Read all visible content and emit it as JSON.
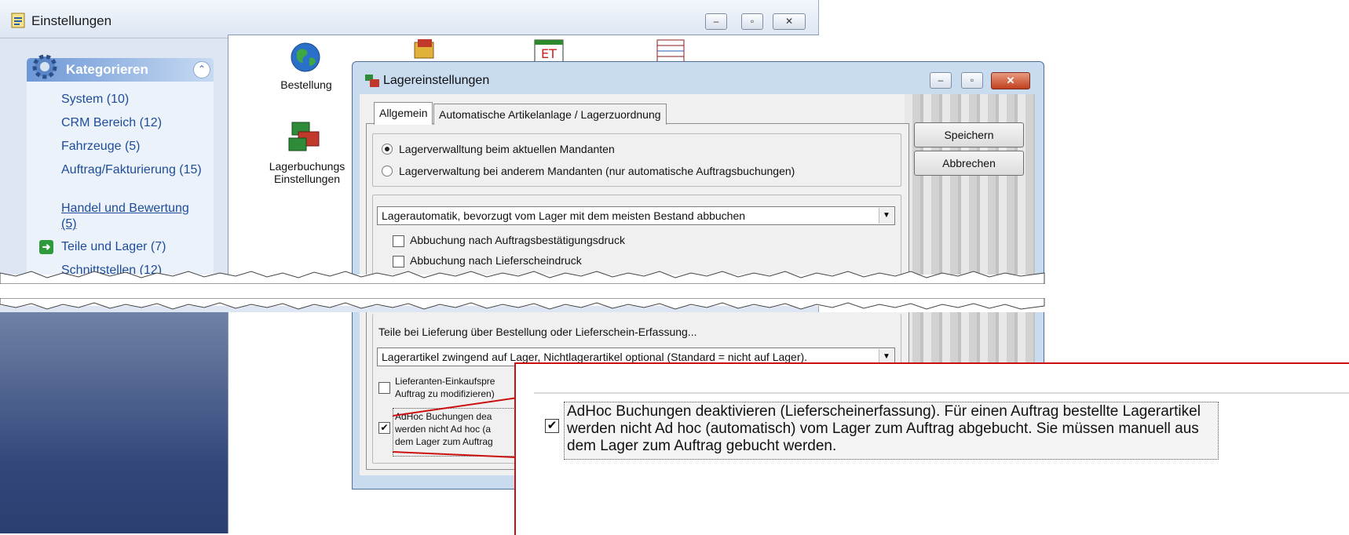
{
  "back_window": {
    "title": "Einstellungen",
    "controls": [
      "–",
      "▫",
      "✕"
    ]
  },
  "sidebar": {
    "header": "Kategorieren",
    "items": [
      {
        "label": "System (10)"
      },
      {
        "label": "CRM Bereich (12)"
      },
      {
        "label": "Fahrzeuge (5)"
      },
      {
        "label": "Auftrag/Fakturierung (15)"
      },
      {
        "label": "Handel und Bewertung (5)"
      },
      {
        "label": "Teile und Lager (7)"
      },
      {
        "label": "Schnittstellen (12)"
      }
    ]
  },
  "tiles": {
    "bestellung": "Bestellung",
    "lager_line1": "Lagerbuchungs",
    "lager_line2": "Einstellungen"
  },
  "dialog": {
    "title": "Lagereinstellungen",
    "tabs": [
      "Allgemein",
      "Automatische Artikelanlage / Lagerzuordnung"
    ],
    "save": "Speichern",
    "cancel": "Abbrechen",
    "radio1": "Lagerverwalltung beim aktuellen Mandanten",
    "radio2": "Lagerverwaltung bei anderem Mandanten (nur automatische Auftragsbuchungen)",
    "combo1": "Lagerautomatik, bevorzugt vom Lager mit dem meisten Bestand abbuchen",
    "check1": "Abbuchung nach Auftragsbestätigungsdruck",
    "check2": "Abbuchung nach Lieferscheindruck",
    "section_label": "Teile bei Lieferung über Bestellung oder Lieferschein-Erfassung...",
    "combo2": "Lagerartikel zwingend auf Lager, Nichtlagerartikel optional (Standard = nicht auf Lager).",
    "check3_l1": "Lieferanten-Einkaufspre",
    "check3_l2": "Auftrag zu modifizieren)",
    "check4_l1": "AdHoc Buchungen dea",
    "check4_l2": "werden nicht Ad hoc (a",
    "check4_l3": "dem Lager zum Auftrag"
  },
  "zoom": {
    "line1": "AdHoc Buchungen deaktivieren (Lieferscheinerfassung). Für einen Auftrag bestellte Lagerartikel",
    "line2": "werden nicht Ad hoc (automatisch) vom Lager zum Auftrag abgebucht. Sie müssen manuell aus",
    "line3": "dem Lager zum Auftrag gebucht werden.",
    "checked": "✔"
  },
  "colors": {
    "accent_red": "#cc1010",
    "link_blue": "#1d4c9c",
    "sidebar_dark": "#33467a"
  }
}
